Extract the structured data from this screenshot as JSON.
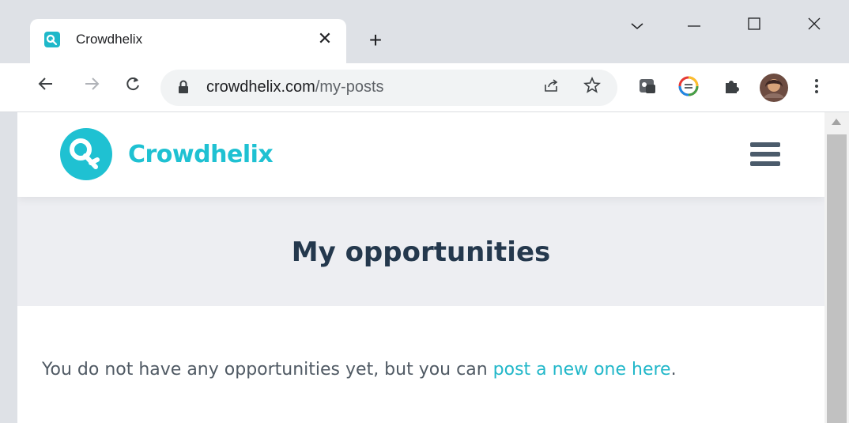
{
  "browser": {
    "tab_title": "Crowdhelix",
    "tab_close": "✕",
    "new_tab": "+",
    "url_domain": "crowdhelix.com",
    "url_path": "/my-posts",
    "window_controls": {
      "minimize": "—",
      "maximize": "☐",
      "close": "✕",
      "dropdown": "⌄"
    }
  },
  "site": {
    "logo_text": "Crowdhelix",
    "brand_color": "#1fc1d2"
  },
  "page": {
    "title": "My opportunities",
    "message_prefix": "You do not have any opportunities yet, but you can ",
    "message_link": "post a new one here",
    "message_suffix": "."
  },
  "icons": [
    "crowdhelix-favicon-icon",
    "back-arrow-icon",
    "forward-arrow-icon",
    "reload-icon",
    "lock-icon",
    "share-icon",
    "star-icon",
    "extension-icon",
    "profile-avatar",
    "menu-icon",
    "hamburger-menu-icon"
  ]
}
